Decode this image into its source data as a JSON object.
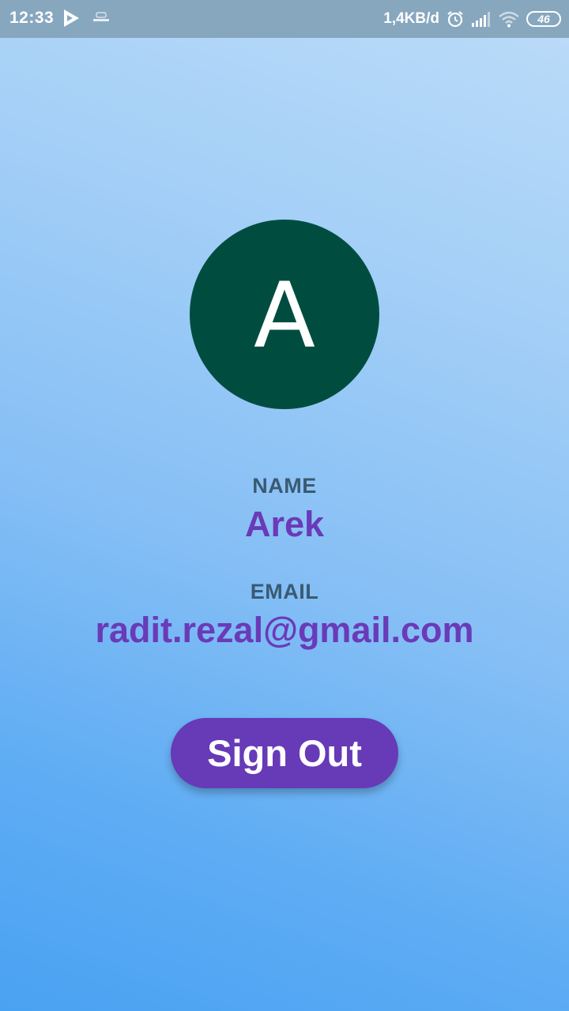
{
  "status_bar": {
    "time": "12:33",
    "network_speed": "1,4KB/d",
    "battery_level": "46",
    "icons": [
      "play-store-icon",
      "notification-app-icon",
      "alarm-icon",
      "signal-icon",
      "wifi-icon",
      "battery-icon"
    ]
  },
  "profile": {
    "avatar_letter": "A",
    "avatar_color": "#004d40",
    "name_label": "NAME",
    "name": "Arek",
    "email_label": "EMAIL",
    "email": "radit.rezal@gmail.com"
  },
  "actions": {
    "sign_out_label": "Sign Out"
  },
  "colors": {
    "accent": "#673ab7",
    "label": "#3a5a73",
    "value": "#6a3ab8"
  }
}
